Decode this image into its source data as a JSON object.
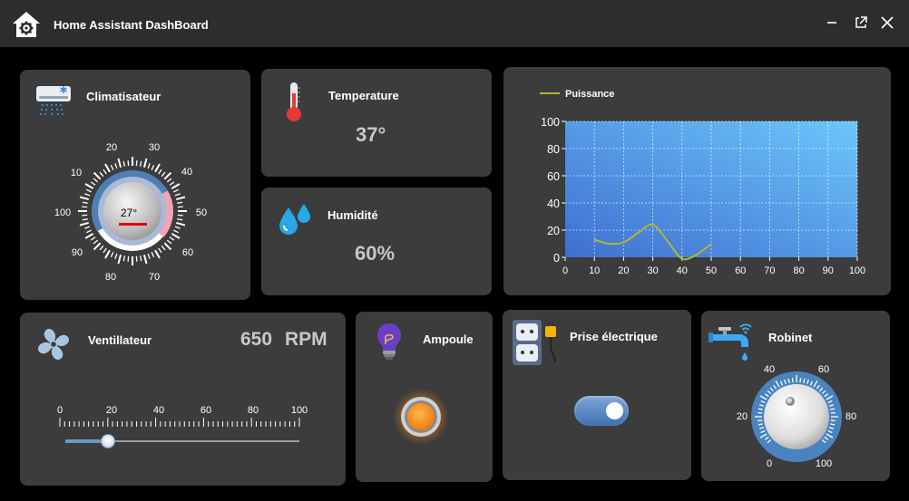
{
  "window": {
    "title": "Home Assistant DashBoard",
    "controls": [
      "minimize",
      "popout",
      "close"
    ]
  },
  "climatiseur": {
    "title": "Climatisateur",
    "value": "27°",
    "dial_labels": [
      "20",
      "30",
      "40",
      "50",
      "60",
      "70",
      "80",
      "90",
      "100",
      "10"
    ],
    "indicator_color": "#e00000"
  },
  "temperature": {
    "title": "Temperature",
    "value": "37°"
  },
  "humidite": {
    "title": "Humidité",
    "value": "60%"
  },
  "puissance": {
    "chart_data": {
      "type": "line",
      "series": [
        {
          "name": "Puissance",
          "x": [
            10,
            15,
            20,
            25,
            30,
            35,
            40,
            45,
            50
          ],
          "values": [
            13,
            10,
            11,
            18,
            24,
            12,
            -1,
            2,
            10
          ]
        }
      ],
      "xlim": [
        0,
        100
      ],
      "ylim": [
        0,
        100
      ],
      "xticks": [
        "0",
        "10",
        "20",
        "30",
        "40",
        "50",
        "60",
        "70",
        "80",
        "90",
        "100"
      ],
      "yticks": [
        "0",
        "20",
        "40",
        "60",
        "80",
        "100"
      ],
      "grid": true,
      "legend": "top-left",
      "line_color": "#b5b531"
    }
  },
  "ventilateur": {
    "title": "Ventillateur",
    "rpm_value": "650",
    "rpm_unit": "RPM",
    "slider_labels": [
      "0",
      "20",
      "40",
      "60",
      "80",
      "100"
    ],
    "slider_value": 20
  },
  "ampoule": {
    "title": "Ampoule"
  },
  "prise": {
    "title": "Prise électrique",
    "toggle_on": true
  },
  "robinet": {
    "title": "Robinet",
    "knob_labels": [
      "40",
      "60",
      "20",
      "80",
      "0",
      "100"
    ]
  }
}
